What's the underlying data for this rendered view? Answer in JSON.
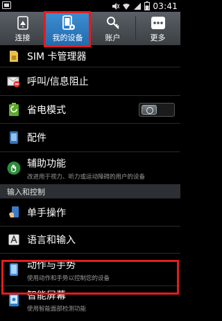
{
  "status_bar": {
    "time": "03:41"
  },
  "tabs": [
    {
      "label": "连接",
      "icon": "connections-icon"
    },
    {
      "label": "我的设备",
      "icon": "my-device-icon",
      "active": true
    },
    {
      "label": "账户",
      "icon": "accounts-icon"
    },
    {
      "label": "更多",
      "icon": "more-icon"
    }
  ],
  "items": {
    "sim": {
      "title": "SIM 卡管理器"
    },
    "call_block": {
      "title": "呼叫/信息阻止"
    },
    "power_saving": {
      "title": "省电模式"
    },
    "accessories": {
      "title": "配件"
    },
    "accessibility": {
      "title": "辅助功能",
      "subtitle": "改进用于视力、听力或运动障碍的用户的设备"
    },
    "section_input": {
      "title": "输入和控制"
    },
    "one_hand": {
      "title": "单手操作"
    },
    "language": {
      "title": "语言和输入"
    },
    "motions": {
      "title": "动作与手势",
      "subtitle": "使用动作和手势以控制您的设备"
    },
    "smart_screen": {
      "title": "智能屏幕",
      "subtitle": "使用智能面部检测功能"
    }
  },
  "colors": {
    "accent": "#2a77bf",
    "highlight": "#e51c1c",
    "background": "#000000"
  }
}
